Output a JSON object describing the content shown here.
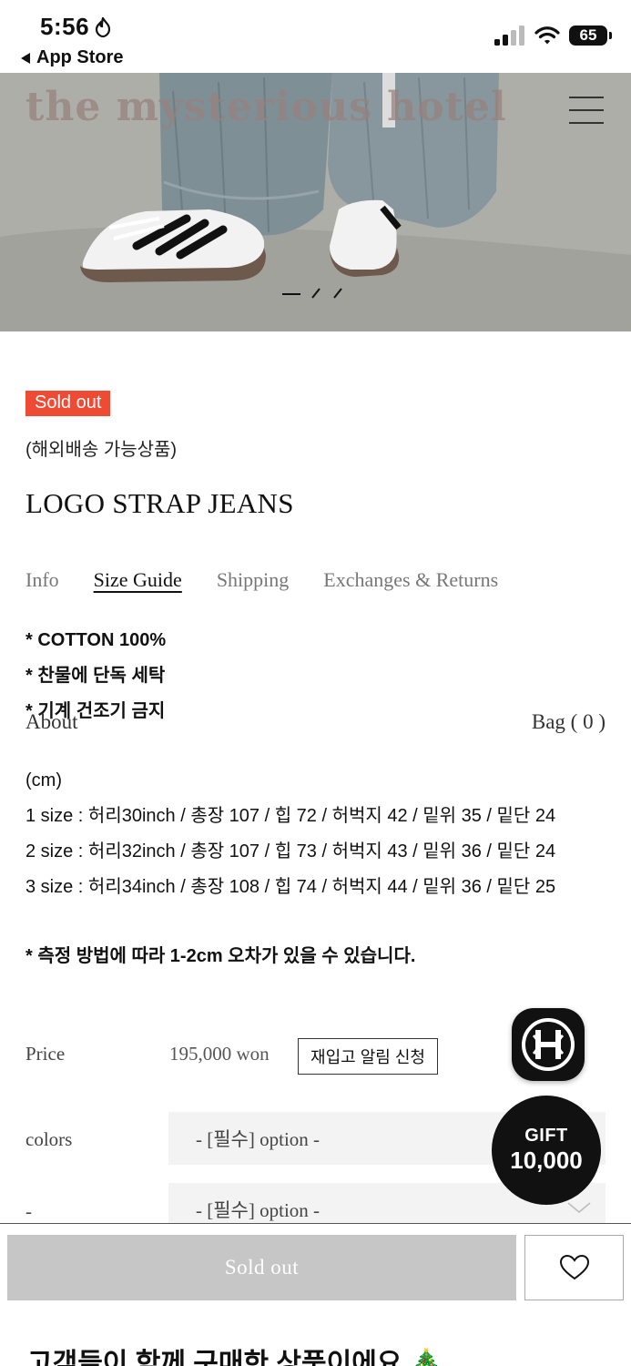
{
  "status_bar": {
    "time": "5:56",
    "back_label": "App Store",
    "battery": "65",
    "icons": [
      "hotspot-icon",
      "signal-icon",
      "wifi-icon",
      "battery-icon"
    ]
  },
  "hero": {
    "logo_text": "the mysterious hotel",
    "menu_icon": "hamburger-icon"
  },
  "product": {
    "badge": "Sold out",
    "shipping_note": "(해외배송 가능상품)",
    "title": "LOGO STRAP JEANS"
  },
  "tabs": [
    {
      "label": "Info",
      "active": false
    },
    {
      "label": "Size Guide",
      "active": true
    },
    {
      "label": "Shipping",
      "active": false
    },
    {
      "label": "Exchanges & Returns",
      "active": false
    }
  ],
  "description": [
    "* COTTON 100%",
    "* 찬물에 단독 세탁",
    "* 기계 건조기 금지"
  ],
  "overlay_nav": {
    "about": "About",
    "bag": "Bag ( 0 )"
  },
  "size_guide": {
    "unit": "(cm)",
    "rows": [
      "1 size : 허리30inch / 총장 107 / 힙 72 / 허벅지 42 / 밑위 35 / 밑단 24",
      "2 size : 허리32inch / 총장 107 / 힙 73 / 허벅지 43 / 밑위 36 / 밑단 24",
      "3 size : 허리34inch / 총장 108 / 힙 74 / 허벅지 44 / 밑위 36 / 밑단 25"
    ],
    "note": "* 측정 방법에 따라 1-2cm 오차가 있을 수 있습니다."
  },
  "options": {
    "price_label": "Price",
    "price_value": "195,000 won",
    "restock_button": "재입고 알림 신청",
    "colors_label": "colors",
    "colors_select": "- [필수] option -",
    "second_label": "-",
    "second_select": "- [필수] option -"
  },
  "floating": {
    "app_logo_icon": "brand-logo-icon",
    "gift_title": "GIFT",
    "gift_amount": "10,000"
  },
  "bottom_bar": {
    "soldout_button": "Sold out",
    "wish_icon": "heart-icon",
    "recommend_title": "고객들이 함께 구매한 상품이에요 🎄"
  },
  "colors": {
    "badge_red": "#ef4a34",
    "soldout_gray": "#c6c6c6",
    "select_bg": "#f3f3f3"
  }
}
